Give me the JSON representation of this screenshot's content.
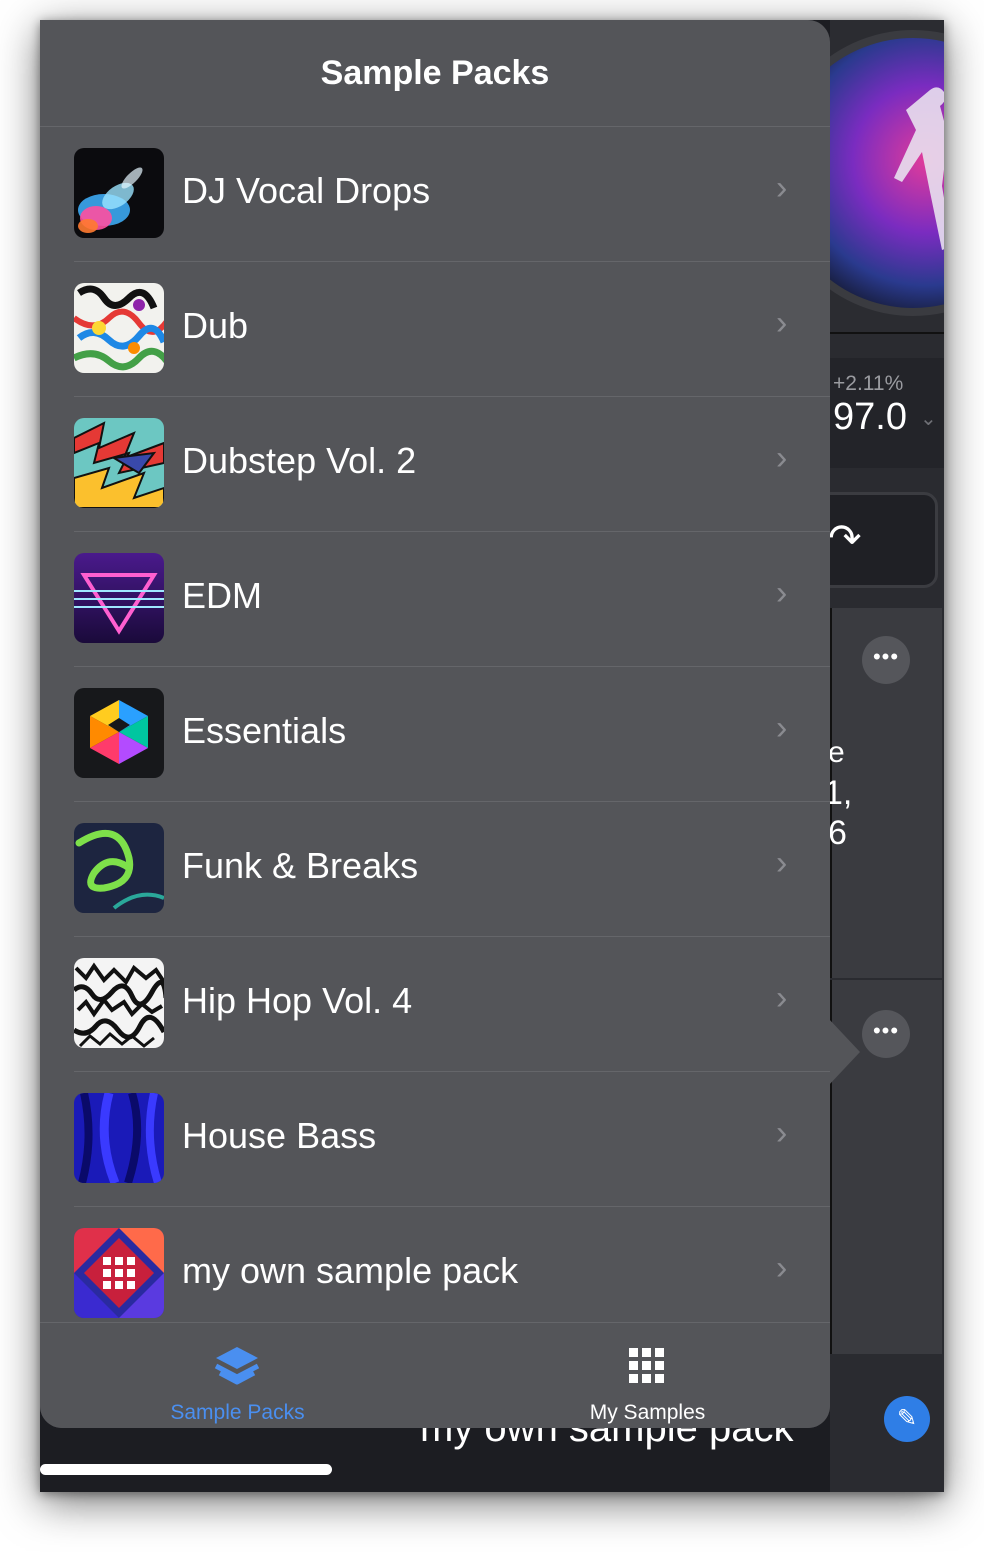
{
  "popover": {
    "title": "Sample Packs",
    "items": [
      {
        "label": "DJ Vocal Drops",
        "icon": "paint-splash-icon"
      },
      {
        "label": "Dub",
        "icon": "psychedelic-pattern-icon"
      },
      {
        "label": "Dubstep Vol. 2",
        "icon": "zigzag-pattern-icon"
      },
      {
        "label": "EDM",
        "icon": "neon-triangle-icon"
      },
      {
        "label": "Essentials",
        "icon": "geometric-cube-icon"
      },
      {
        "label": "Funk & Breaks",
        "icon": "swirl-icon"
      },
      {
        "label": "Hip Hop Vol. 4",
        "icon": "graffiti-pattern-icon"
      },
      {
        "label": "House Bass",
        "icon": "blue-fabric-icon"
      },
      {
        "label": "my own sample pack",
        "icon": "grid-pack-icon"
      }
    ],
    "tabs": [
      {
        "label": "Sample Packs",
        "icon": "layers-icon",
        "selected": true
      },
      {
        "label": "My Samples",
        "icon": "grid-icon",
        "selected": false
      }
    ]
  },
  "background": {
    "pitch_percent": "+2.11%",
    "bpm": "97.0",
    "fragments": [
      "e",
      "1,",
      "6"
    ],
    "bottom_text": "my own sample pack"
  },
  "colors": {
    "accent": "#4a8ff0",
    "panel": "#545559",
    "text": "#ffffff"
  }
}
